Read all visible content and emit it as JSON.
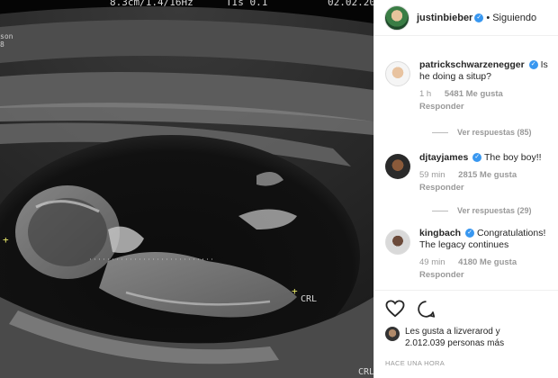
{
  "ultrasound": {
    "depth_text": "8.3cm/1.4/16Hz",
    "tis_text": "TIs  0.1",
    "date_text": "02.02.201",
    "side_text": "son\n8",
    "crl_marker_1": "CRL",
    "crl_marker_2": "CRL"
  },
  "header": {
    "username": "justinbieber",
    "separator": "•",
    "follow_status": "Siguiendo"
  },
  "comments": [
    {
      "username": "patrickschwarzenegger",
      "text": "Is he doing a situp?",
      "time": "1 h",
      "likes": "5481 Me gusta",
      "reply_label": "Responder",
      "replies_label": "Ver respuestas (85)"
    },
    {
      "username": "djtayjames",
      "text": "The boy boy!!",
      "time": "59 min",
      "likes": "2815 Me gusta",
      "reply_label": "Responder",
      "replies_label": "Ver respuestas (29)"
    },
    {
      "username": "kingbach",
      "text": "Congratulations! The legacy continues",
      "time": "49 min",
      "likes": "4180 Me gusta",
      "reply_label": "Responder"
    }
  ],
  "actions": {
    "likes_summary_line1": "Les gusta a lizverarod y",
    "likes_summary_line2": "2.012.039 personas más",
    "time_ago": "HACE UNA HORA"
  },
  "icons": {
    "like": "heart-icon",
    "comment": "comment-icon",
    "verified": "verified-badge-icon"
  },
  "colors": {
    "verified_blue": "#3897f0",
    "meta_gray": "#999999",
    "text_dark": "#262626"
  }
}
